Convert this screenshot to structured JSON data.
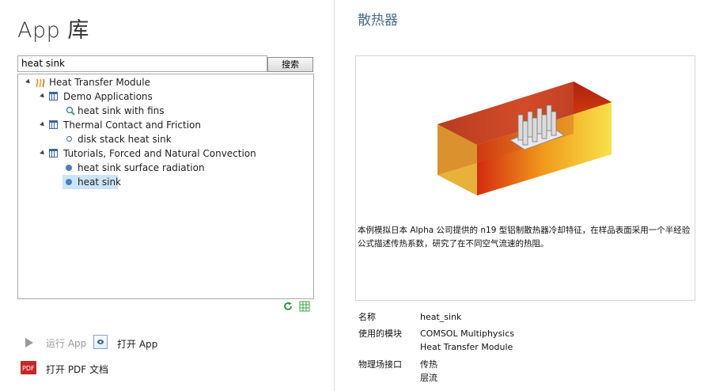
{
  "library": {
    "title": "App 库",
    "search": {
      "value": "heat sink",
      "button": "搜索"
    },
    "tree": {
      "root": "Heat Transfer Module",
      "groups": [
        {
          "label": "Demo Applications",
          "items": [
            "heat sink with fins"
          ]
        },
        {
          "label": "Thermal Contact and Friction",
          "items": [
            "disk stack heat sink"
          ]
        },
        {
          "label": "Tutorials, Forced and Natural Convection",
          "items": [
            "heat sink surface radiation",
            "heat sink"
          ]
        }
      ],
      "selected": "heat sink"
    },
    "actions": {
      "run_app": "运行 App",
      "open_app": "打开 App",
      "open_pdf": "打开 PDF 文档"
    }
  },
  "detail": {
    "title": "散热器",
    "description": "本例模拟日本 Alpha 公司提供的 n19 型铝制散热器冷却特征，在样品表面采用一个半经验公式描述传热系数，研究了在不同空气流速的热阻。",
    "fields": [
      {
        "key": "名称",
        "values": [
          "heat_sink"
        ]
      },
      {
        "key": "使用的模块",
        "values": [
          "COMSOL Multiphysics",
          "Heat Transfer Module"
        ]
      },
      {
        "key": "物理场接口",
        "values": [
          "传热",
          "层流"
        ]
      }
    ]
  },
  "icons": [
    "heat-transfer-icon",
    "grid-icon",
    "refresh-icon",
    "table-icon",
    "run-icon",
    "open-app-icon",
    "pdf-icon"
  ]
}
